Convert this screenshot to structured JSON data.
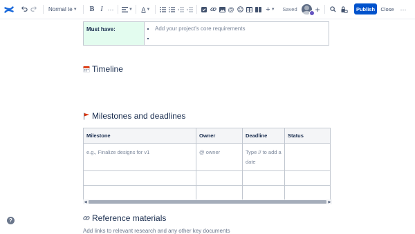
{
  "toolbar": {
    "icons": [
      "confluence-logo-icon",
      "undo-icon",
      "redo-icon",
      "bold-icon",
      "italic-icon",
      "more-formatting-icon",
      "align-icon",
      "text-color-icon",
      "bullet-list-icon",
      "numbered-list-icon",
      "outdent-icon",
      "indent-icon",
      "action-item-icon",
      "link-icon",
      "image-icon",
      "mention-icon",
      "emoji-icon",
      "table-icon",
      "layouts-icon",
      "insert-icon",
      "search-icon",
      "restrictions-icon",
      "more-icon"
    ],
    "text_style": "Normal te",
    "bold": "B",
    "italic": "I",
    "more_formatting": "···",
    "text_color": "A",
    "insert": "+",
    "saved": "Saved",
    "add_collaborator": "+",
    "publish": "Publish",
    "close": "Close",
    "more": "···"
  },
  "must_have": {
    "label": "Must have:",
    "items": [
      "Add your project's core requirements",
      ""
    ]
  },
  "timeline": {
    "icon": "calendar-icon",
    "title": "Timeline"
  },
  "milestones": {
    "icon": "flag-icon",
    "title": "Milestones and deadlines",
    "columns": [
      "Milestone",
      "Owner",
      "Deadline",
      "Status"
    ],
    "rows": [
      [
        "e.g., Finalize designs for v1",
        "@ owner",
        "Type // to add a date",
        ""
      ],
      [
        "",
        "",
        "",
        ""
      ],
      [
        "",
        "",
        "",
        ""
      ]
    ]
  },
  "scrollbar": {
    "left_arrow": "◀",
    "right_arrow": "▶"
  },
  "reference": {
    "icon": "link-icon",
    "title": "Reference materials",
    "description": "Add links to relevant research and any other key documents"
  },
  "help": {
    "label": "?"
  },
  "colors": {
    "accent": "#0052cc",
    "must_have_bg": "#e3fcef",
    "text": "#172b4d"
  }
}
